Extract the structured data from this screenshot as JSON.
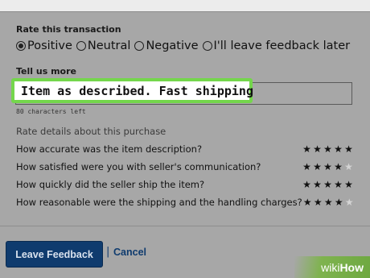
{
  "rate_transaction": {
    "title": "Rate this transaction",
    "options": [
      {
        "label": "Positive",
        "selected": true
      },
      {
        "label": "Neutral",
        "selected": false
      },
      {
        "label": "Negative",
        "selected": false
      },
      {
        "label": "I'll leave feedback later",
        "selected": false
      }
    ]
  },
  "tell_us_more": {
    "title": "Tell us more",
    "value": "Item as described. Fast shipping",
    "chars_left": "80 characters left",
    "highlight_color": "#74d64c"
  },
  "details": {
    "title": "Rate details about this purchase",
    "questions": [
      {
        "text": "How accurate was the item description?",
        "stars": 5,
        "max": 5
      },
      {
        "text": "How satisfied were you with seller's communication?",
        "stars": 4,
        "max": 5
      },
      {
        "text": "How quickly did the seller ship the item?",
        "stars": 5,
        "max": 5
      },
      {
        "text": "How reasonable were the shipping and the handling charges?",
        "stars": 4,
        "max": 5
      }
    ]
  },
  "actions": {
    "leave_feedback_label": "Leave Feedback",
    "separator": "|",
    "cancel_label": "Cancel",
    "primary_color": "#0f3b6e"
  },
  "watermark": {
    "part1": "wiki",
    "part2": "How"
  }
}
